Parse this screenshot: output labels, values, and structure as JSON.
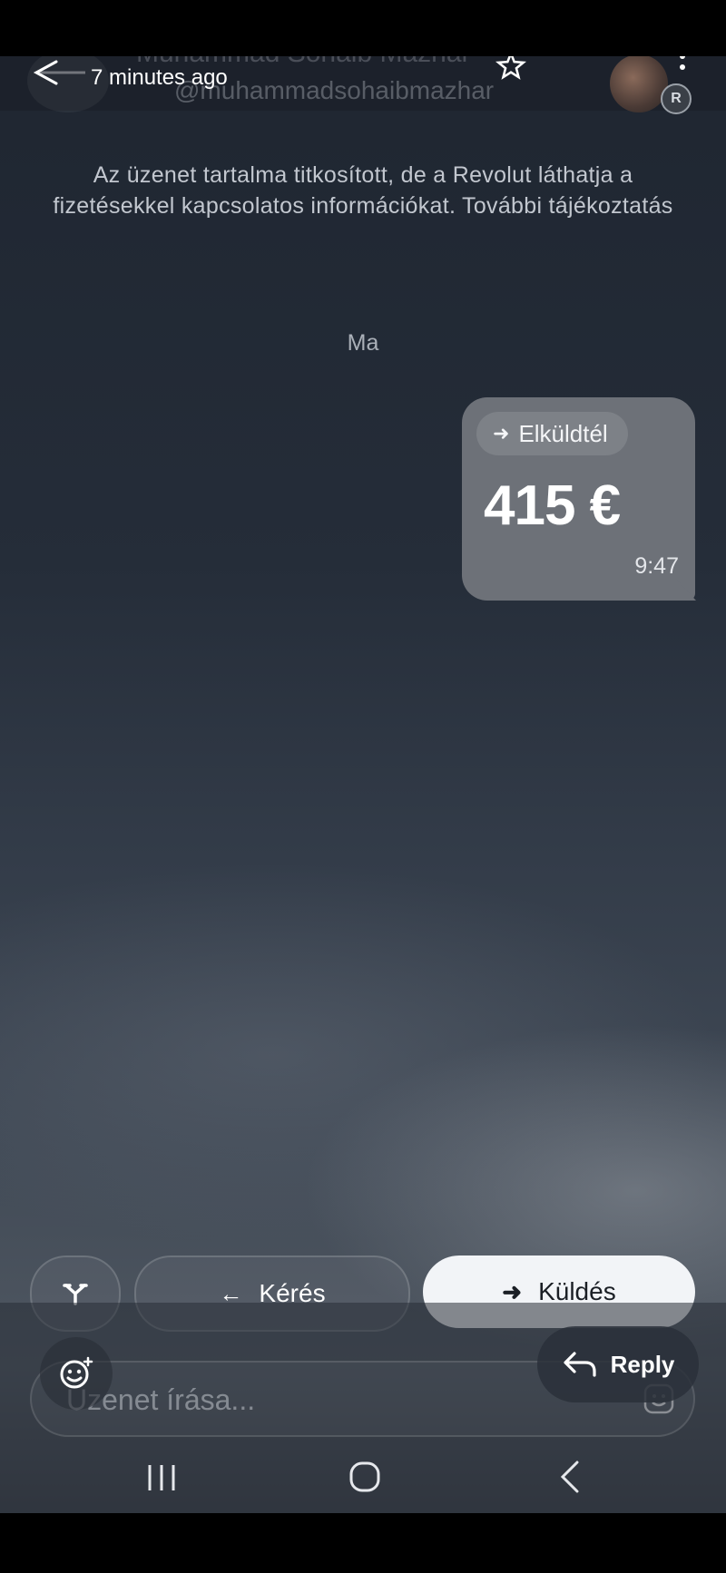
{
  "header": {
    "contact_name": "Muhammad Sohaib Mazhar",
    "contact_handle": "@muhammadsohaibmazhar",
    "time_ago": "7 minutes ago",
    "avatar_badge": "R"
  },
  "notice": {
    "text": "Az üzenet tartalma titkosított, de a Revolut láthatja a fizetésekkel kapcsolatos információkat.",
    "link": "További tájékoztatás"
  },
  "date_separator": "Ma",
  "message": {
    "type_label": "Elküldtél",
    "amount": "415 €",
    "time": "9:47"
  },
  "actions": {
    "request_label": "Kérés",
    "send_label": "Küldés",
    "reply_label": "Reply"
  },
  "composer": {
    "placeholder": "Üzenet írása...",
    "value": ""
  },
  "colors": {
    "bubble": "#6d7178",
    "send_button": "#f2f4f7"
  }
}
